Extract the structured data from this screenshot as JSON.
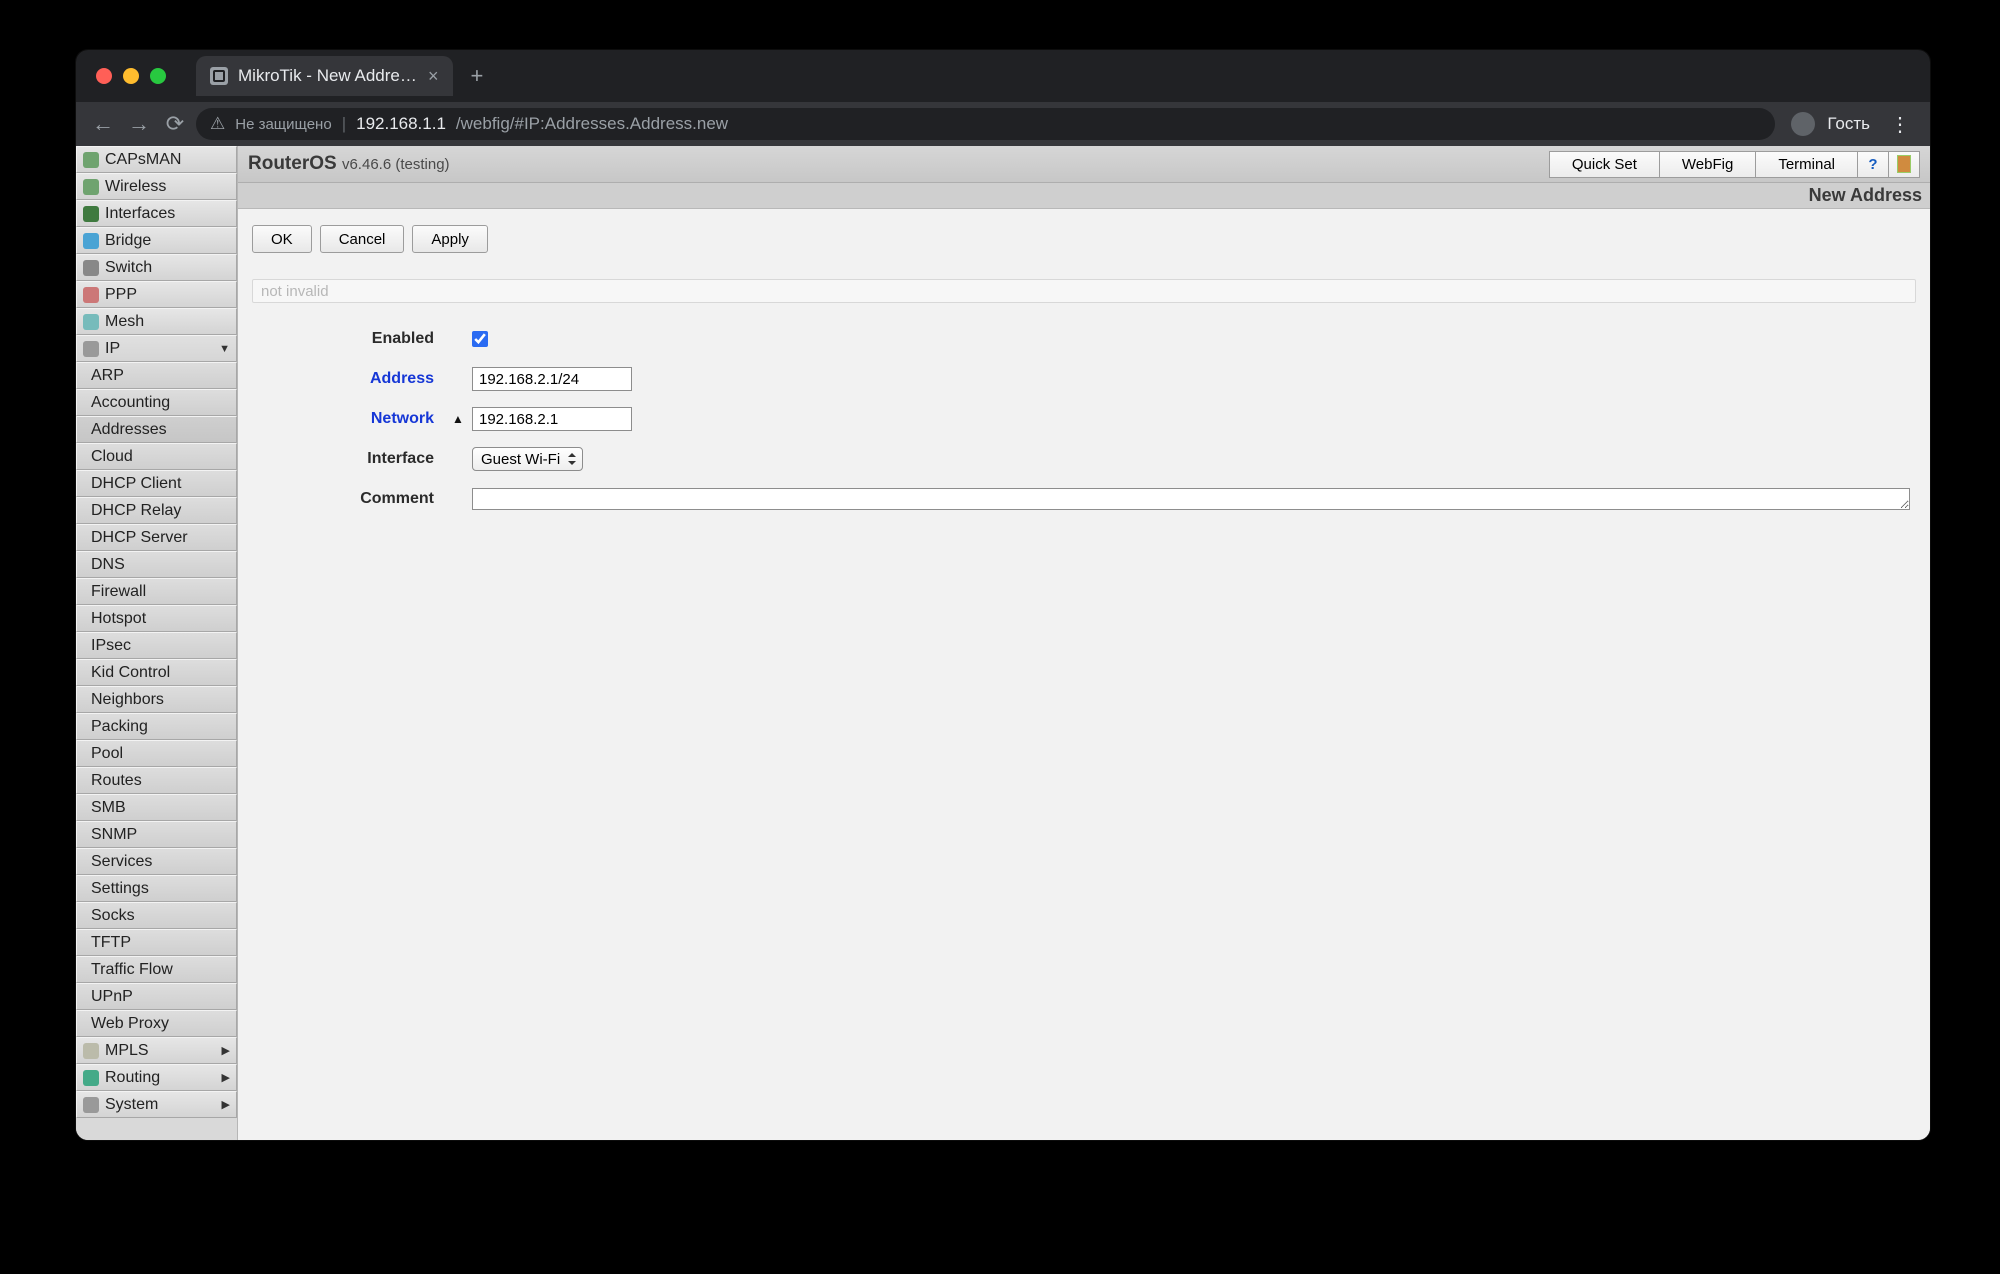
{
  "browser": {
    "tab_title": "MikroTik - New Address at adm",
    "secure_label": "Не защищено",
    "host": "192.168.1.1",
    "path": "/webfig/#IP:Addresses.Address.new",
    "guest_label": "Гость"
  },
  "header": {
    "brand": "RouterOS",
    "version": "v6.46.6 (testing)",
    "buttons": {
      "quickset": "Quick Set",
      "webfig": "WebFig",
      "terminal": "Terminal"
    },
    "page_title": "New Address"
  },
  "sidebar": {
    "top": [
      {
        "key": "capsman",
        "label": "CAPsMAN",
        "icon": "#6fa36f"
      },
      {
        "key": "wireless",
        "label": "Wireless",
        "icon": "#6fa36f"
      },
      {
        "key": "interfaces",
        "label": "Interfaces",
        "icon": "#3f7a3f"
      },
      {
        "key": "bridge",
        "label": "Bridge",
        "icon": "#4aa3d4"
      },
      {
        "key": "switch",
        "label": "Switch",
        "icon": "#888"
      },
      {
        "key": "ppp",
        "label": "PPP",
        "icon": "#c77"
      },
      {
        "key": "mesh",
        "label": "Mesh",
        "icon": "#7bb"
      },
      {
        "key": "ip",
        "label": "IP",
        "icon": "#999",
        "expand": true
      }
    ],
    "ip_sub": [
      "ARP",
      "Accounting",
      "Addresses",
      "Cloud",
      "DHCP Client",
      "DHCP Relay",
      "DHCP Server",
      "DNS",
      "Firewall",
      "Hotspot",
      "IPsec",
      "Kid Control",
      "Neighbors",
      "Packing",
      "Pool",
      "Routes",
      "SMB",
      "SNMP",
      "Services",
      "Settings",
      "Socks",
      "TFTP",
      "Traffic Flow",
      "UPnP",
      "Web Proxy"
    ],
    "ip_active_index": 2,
    "bottom": [
      {
        "key": "mpls",
        "label": "MPLS",
        "icon": "#bba",
        "caret": true
      },
      {
        "key": "routing",
        "label": "Routing",
        "icon": "#4a8",
        "caret": true
      },
      {
        "key": "system",
        "label": "System",
        "icon": "#999",
        "caret": true
      }
    ]
  },
  "actions": {
    "ok": "OK",
    "cancel": "Cancel",
    "apply": "Apply"
  },
  "status_text": "not invalid",
  "form": {
    "enabled": {
      "label": "Enabled",
      "value": true
    },
    "address": {
      "label": "Address",
      "value": "192.168.2.1/24"
    },
    "network": {
      "label": "Network",
      "value": "192.168.2.1"
    },
    "interface": {
      "label": "Interface",
      "value": "Guest Wi-Fi"
    },
    "comment": {
      "label": "Comment",
      "value": ""
    }
  }
}
